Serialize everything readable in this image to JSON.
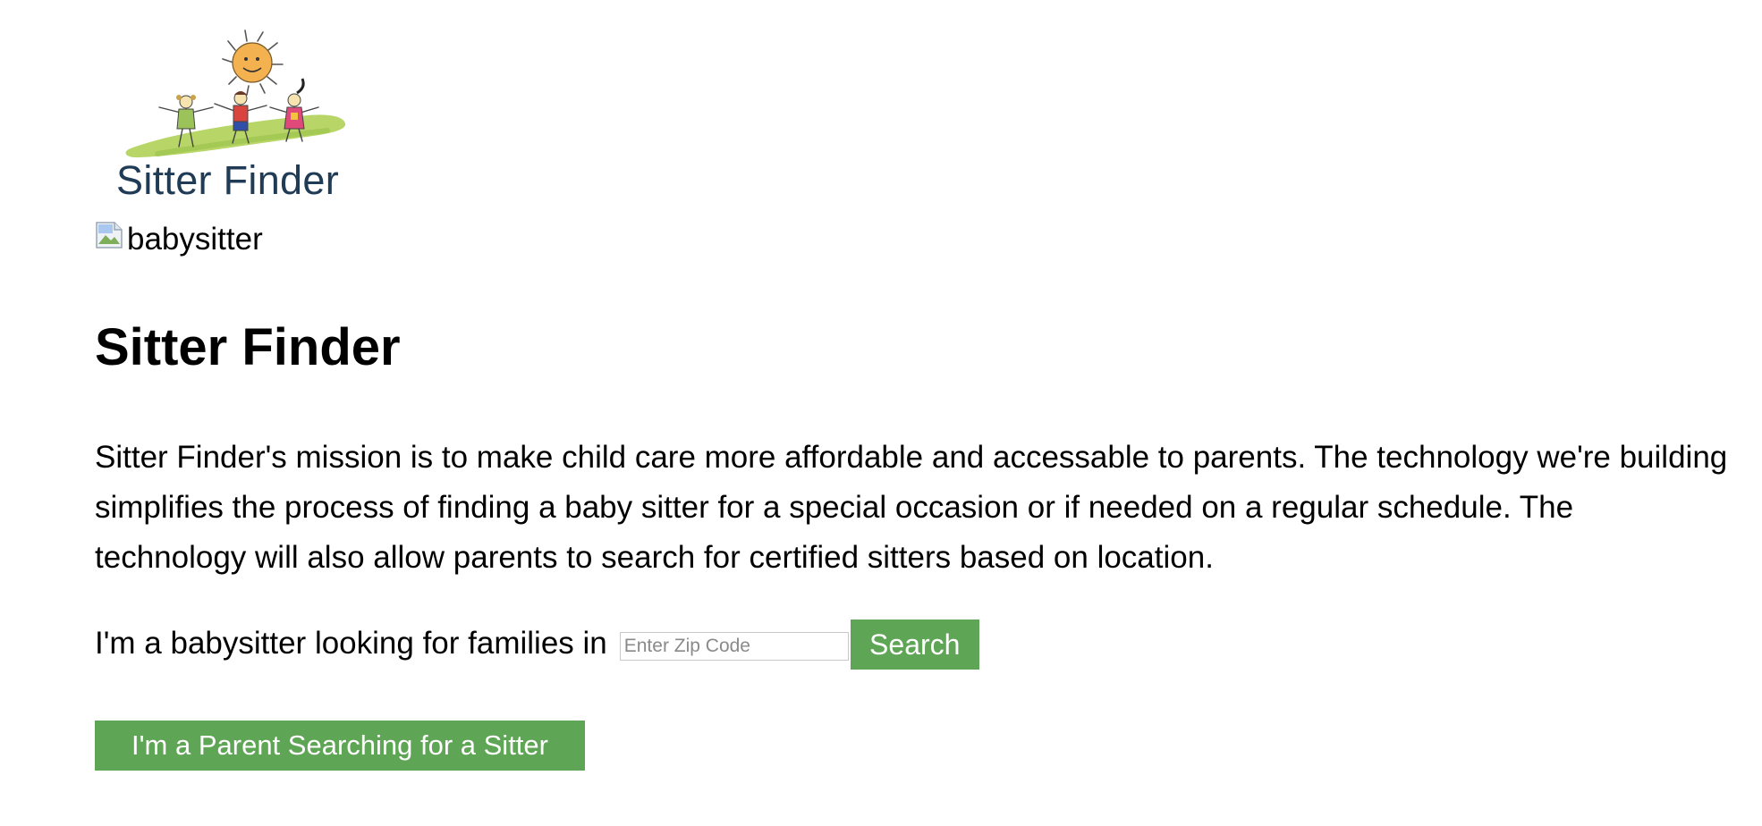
{
  "logo": {
    "text": "Sitter Finder",
    "icon": "sitter-finder-logo",
    "colors": {
      "sun": "#f3b14f",
      "grass": "#b8d668",
      "text": "#1f3b55"
    }
  },
  "hero_image": {
    "alt": "babysitter",
    "icon": "broken-image-icon"
  },
  "main": {
    "title": "Sitter Finder",
    "mission": "Sitter Finder's mission is to make child care more affordable and accessable to parents. The technology we're building simplifies the process of finding a baby sitter for a special occasion or if needed on a regular schedule. The technology will also allow parents to search for certified sitters based on location.",
    "sitter_search": {
      "label": "I'm a babysitter looking for families in",
      "zip_value": "",
      "zip_placeholder": "Enter Zip Code",
      "search_label": "Search"
    },
    "parent_button_label": "I'm a Parent Searching for a Sitter"
  },
  "colors": {
    "accent": "#5fa556",
    "button_text": "#ffffff"
  }
}
